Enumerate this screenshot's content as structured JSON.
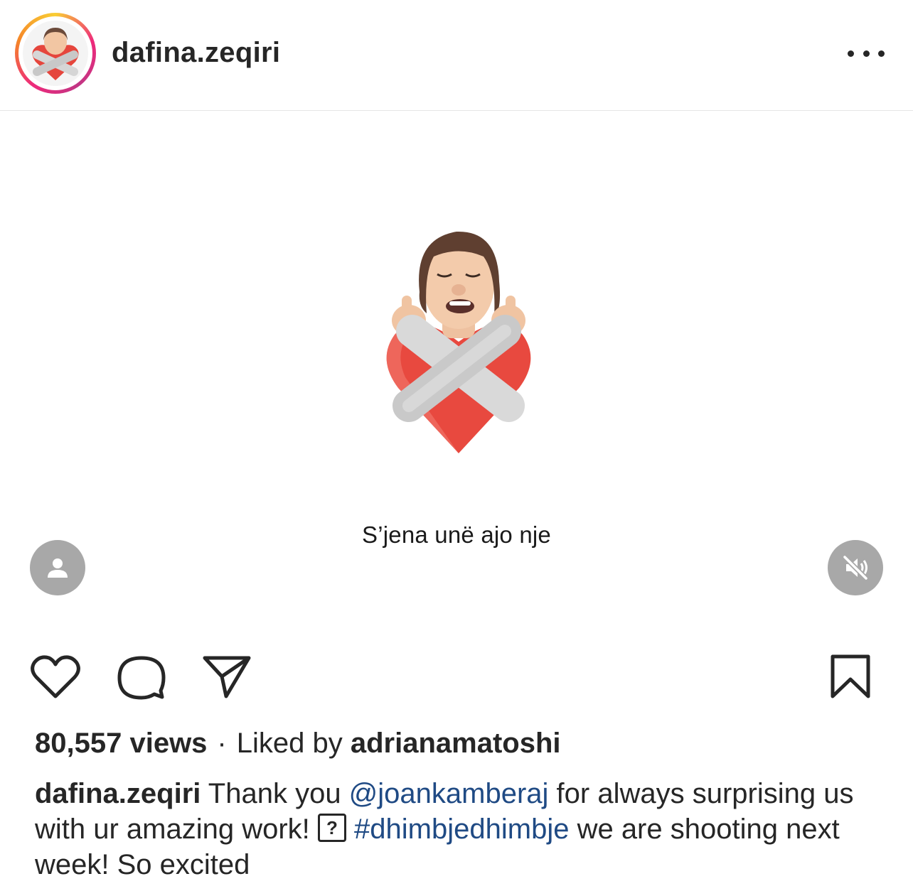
{
  "post": {
    "username": "dafina.zeqiri",
    "media_caption": "S’jena unë ajo nje",
    "views": "80,557 views",
    "liked_by_prefix": "Liked by",
    "liked_by_user": "adrianamatoshi",
    "caption_user": "dafina.zeqiri",
    "caption_part1": " Thank you ",
    "caption_mention": "@joankamberaj",
    "caption_part2": " for always surprising us with ur amazing work! ",
    "caption_emoji": "?",
    "caption_hashtag": "#dhimbjedhimbje",
    "caption_part3": " we are shooting next week! So excited"
  },
  "colors": {
    "link": "#1f4a84",
    "overlay_button": "#a8a8a8",
    "text": "#262626"
  },
  "icons": [
    "more-options-icon",
    "user-tag-icon",
    "sound-off-icon",
    "heart-icon",
    "comment-icon",
    "share-icon",
    "bookmark-icon"
  ]
}
